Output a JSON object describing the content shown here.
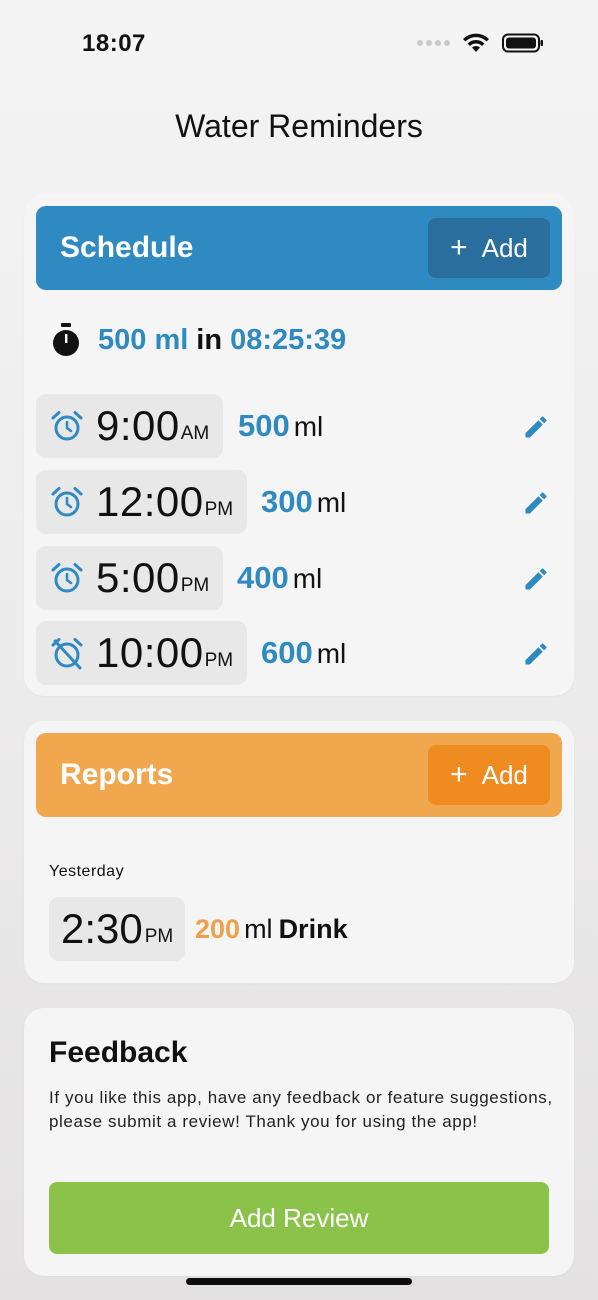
{
  "status_bar": {
    "time": "18:07"
  },
  "page": {
    "title": "Water Reminders"
  },
  "colors": {
    "schedule": "#2f8ac2",
    "schedule_button": "#2a6e9e",
    "reports": "#f0a74e",
    "reports_button": "#ee8c22",
    "review": "#8bc34a"
  },
  "schedule": {
    "title": "Schedule",
    "add_label": "Add",
    "next": {
      "amount": "500 ml",
      "connector": "in",
      "countdown": "08:25:39"
    },
    "items": [
      {
        "time": "9:00",
        "period": "AM",
        "amount": "500",
        "unit": "ml",
        "alarm_icon": "alarm-icon"
      },
      {
        "time": "12:00",
        "period": "PM",
        "amount": "300",
        "unit": "ml",
        "alarm_icon": "alarm-icon"
      },
      {
        "time": "5:00",
        "period": "PM",
        "amount": "400",
        "unit": "ml",
        "alarm_icon": "alarm-icon"
      },
      {
        "time": "10:00",
        "period": "PM",
        "amount": "600",
        "unit": "ml",
        "alarm_icon": "alarm-off-icon"
      }
    ]
  },
  "reports": {
    "title": "Reports",
    "add_label": "Add",
    "day": "Yesterday",
    "entry": {
      "time": "2:30",
      "period": "PM",
      "amount": "200",
      "unit": "ml",
      "kind": "Drink"
    }
  },
  "feedback": {
    "title": "Feedback",
    "text": "If you like this app, have any feedback or feature suggestions, please submit a review! Thank you for using the app!",
    "button": "Add Review"
  }
}
